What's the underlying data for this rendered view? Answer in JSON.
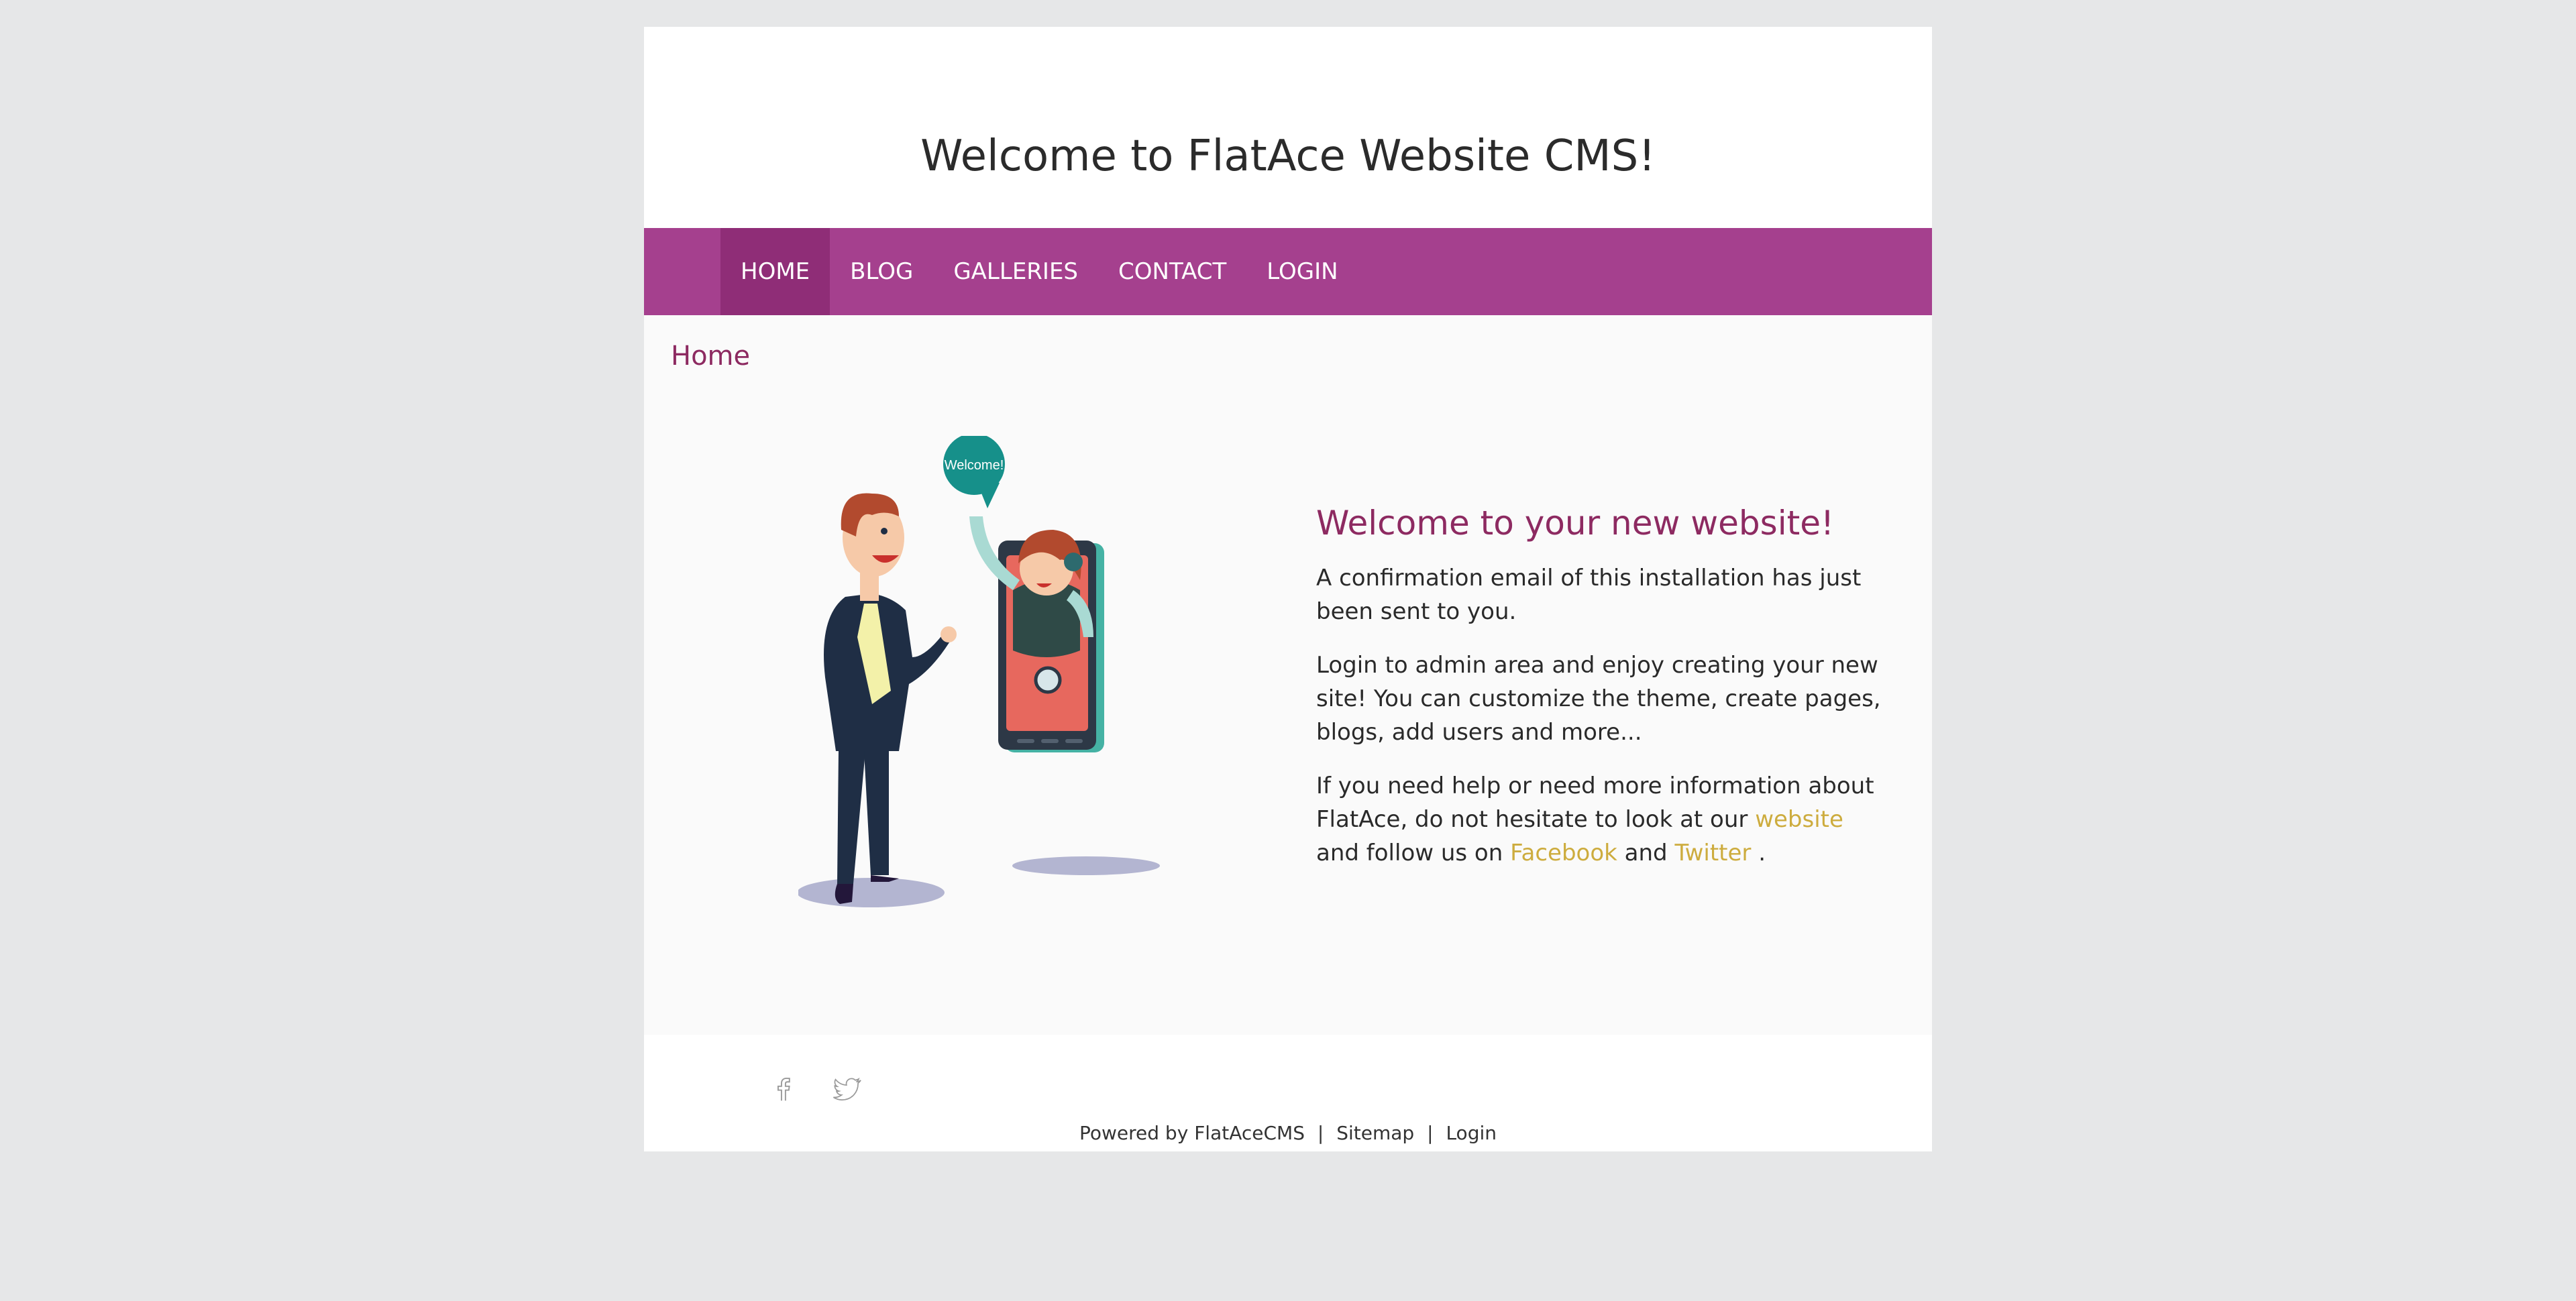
{
  "header": {
    "title": "Welcome to FlatAce Website CMS!"
  },
  "nav": {
    "items": [
      {
        "label": "HOME",
        "active": true
      },
      {
        "label": "BLOG"
      },
      {
        "label": "GALLERIES"
      },
      {
        "label": "CONTACT"
      },
      {
        "label": "LOGIN"
      }
    ]
  },
  "breadcrumb": {
    "current": "Home"
  },
  "illustration": {
    "speech_bubble": "Welcome!"
  },
  "main": {
    "heading": "Welcome to your new website!",
    "p1": "A confirmation email of this installation has just been sent to you.",
    "p2": "Login to admin area and enjoy creating your new site! You can customize the theme, create pages, blogs, add users and more...",
    "p3_a": "If you need help or need more information about FlatAce, do not hesitate to look at our",
    "p3_link_website": "website",
    "p3_b": "and follow us on",
    "p3_link_facebook": "Facebook",
    "p3_c": "and",
    "p3_link_twitter": "Twitter",
    "p3_d": "."
  },
  "footer": {
    "social": [
      "facebook-icon",
      "twitter-icon"
    ],
    "powered_prefix": "Powered by",
    "powered_link": "FlatAceCMS",
    "separator": "|",
    "sitemap": "Sitemap",
    "login": "Login"
  },
  "colors": {
    "background": "#e6e7e8",
    "nav": "#a5408e",
    "nav_active": "#8f2d77",
    "accent_heading": "#8d2a61",
    "link": "#cdac3e"
  }
}
